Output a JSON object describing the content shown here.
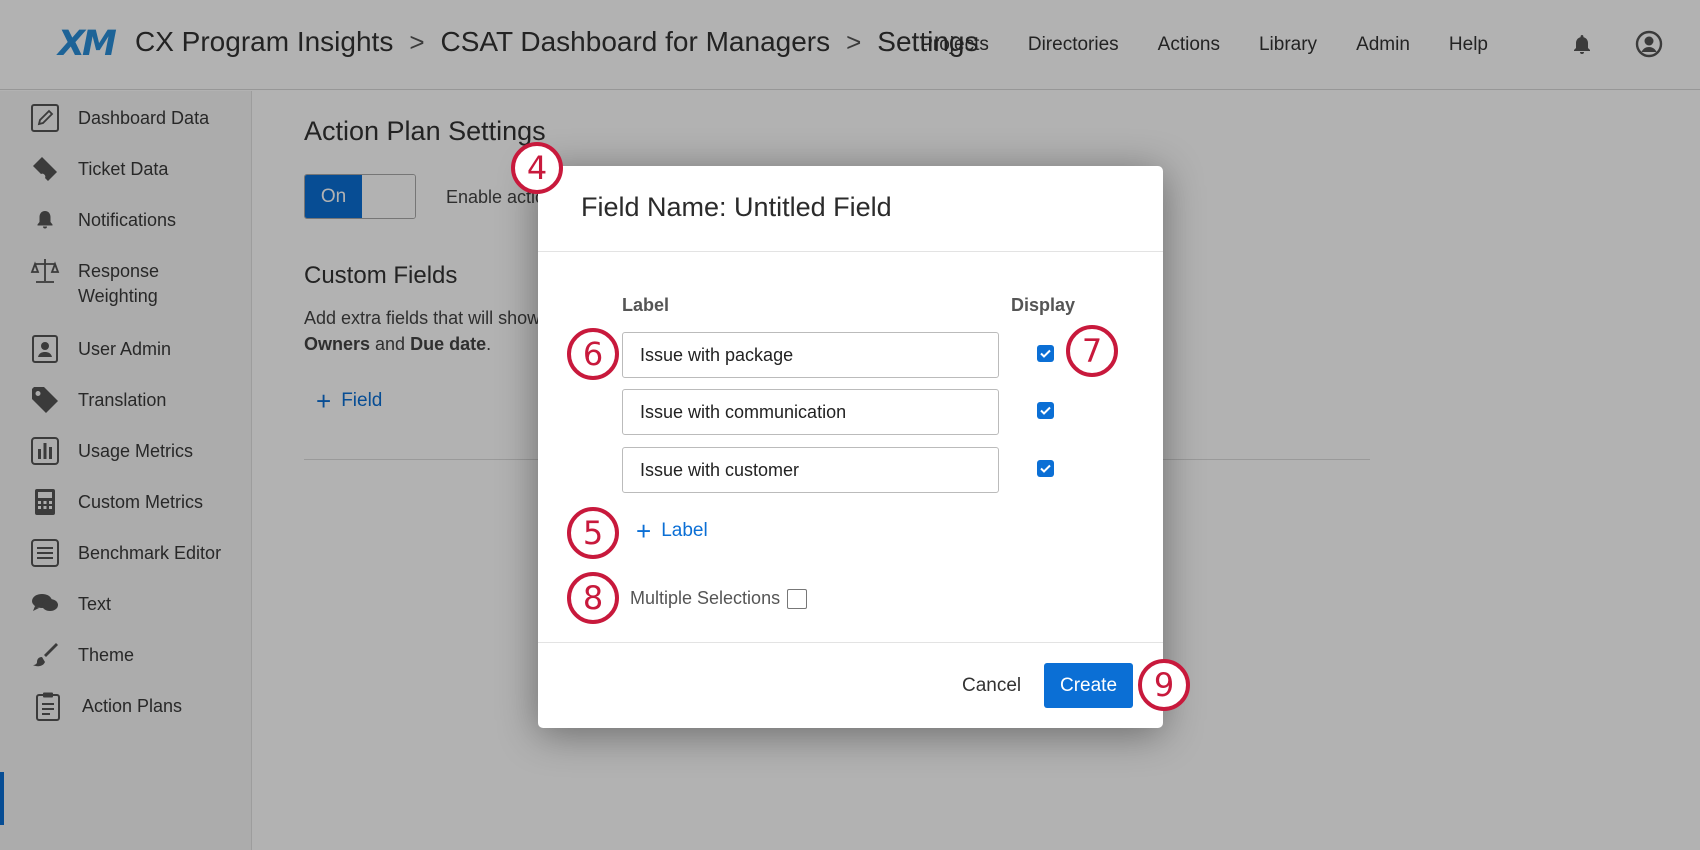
{
  "header": {
    "logo": "XM",
    "breadcrumbs": [
      "CX Program Insights",
      "CSAT Dashboard for Managers",
      "Settings"
    ],
    "breadcrumb_separator": ">",
    "nav": [
      "Projects",
      "Directories",
      "Actions",
      "Library",
      "Admin",
      "Help"
    ],
    "icons": {
      "notifications": "bell-icon",
      "account": "user-circle-icon"
    }
  },
  "sidebar": {
    "items": [
      {
        "label": "Dashboard Data",
        "icon": "pencil-icon"
      },
      {
        "label": "Ticket Data",
        "icon": "ticket-icon"
      },
      {
        "label": "Notifications",
        "icon": "bell-icon"
      },
      {
        "label": "Response\nWeighting",
        "icon": "scale-icon"
      },
      {
        "label": "User Admin",
        "icon": "user-card-icon"
      },
      {
        "label": "Translation",
        "icon": "tag-icon"
      },
      {
        "label": "Usage Metrics",
        "icon": "bar-chart-icon"
      },
      {
        "label": "Custom Metrics",
        "icon": "calculator-icon"
      },
      {
        "label": "Benchmark Editor",
        "icon": "list-icon"
      },
      {
        "label": "Text",
        "icon": "chat-bubbles-icon"
      },
      {
        "label": "Theme",
        "icon": "paintbrush-icon"
      },
      {
        "label": "Action Plans",
        "icon": "clipboard-icon"
      }
    ],
    "active": "Action Plans"
  },
  "main": {
    "title": "Action Plan Settings",
    "toggle": {
      "on_label": "On",
      "state": "on"
    },
    "enable_text": "Enable actio",
    "custom_fields": {
      "title": "Custom Fields",
      "desc_line1": "Add extra fields that will show",
      "desc_owners": "Owners",
      "desc_and": " and ",
      "desc_due": "Due date",
      "desc_period": ".",
      "add_field": "Field"
    }
  },
  "modal": {
    "title": "Field Name: Untitled Field",
    "col_label": "Label",
    "col_display": "Display",
    "rows": [
      {
        "value": "Issue with package",
        "display": true
      },
      {
        "value": "Issue with communication",
        "display": true
      },
      {
        "value": "Issue with customer",
        "display": true
      }
    ],
    "add_label": "Label",
    "multiple_selections": "Multiple Selections",
    "multiple_selections_checked": false,
    "cancel": "Cancel",
    "create": "Create"
  },
  "callouts": [
    "4",
    "6",
    "7",
    "5",
    "8",
    "9"
  ],
  "colors": {
    "accent": "#0b6fd5",
    "callout": "#c8193c"
  }
}
